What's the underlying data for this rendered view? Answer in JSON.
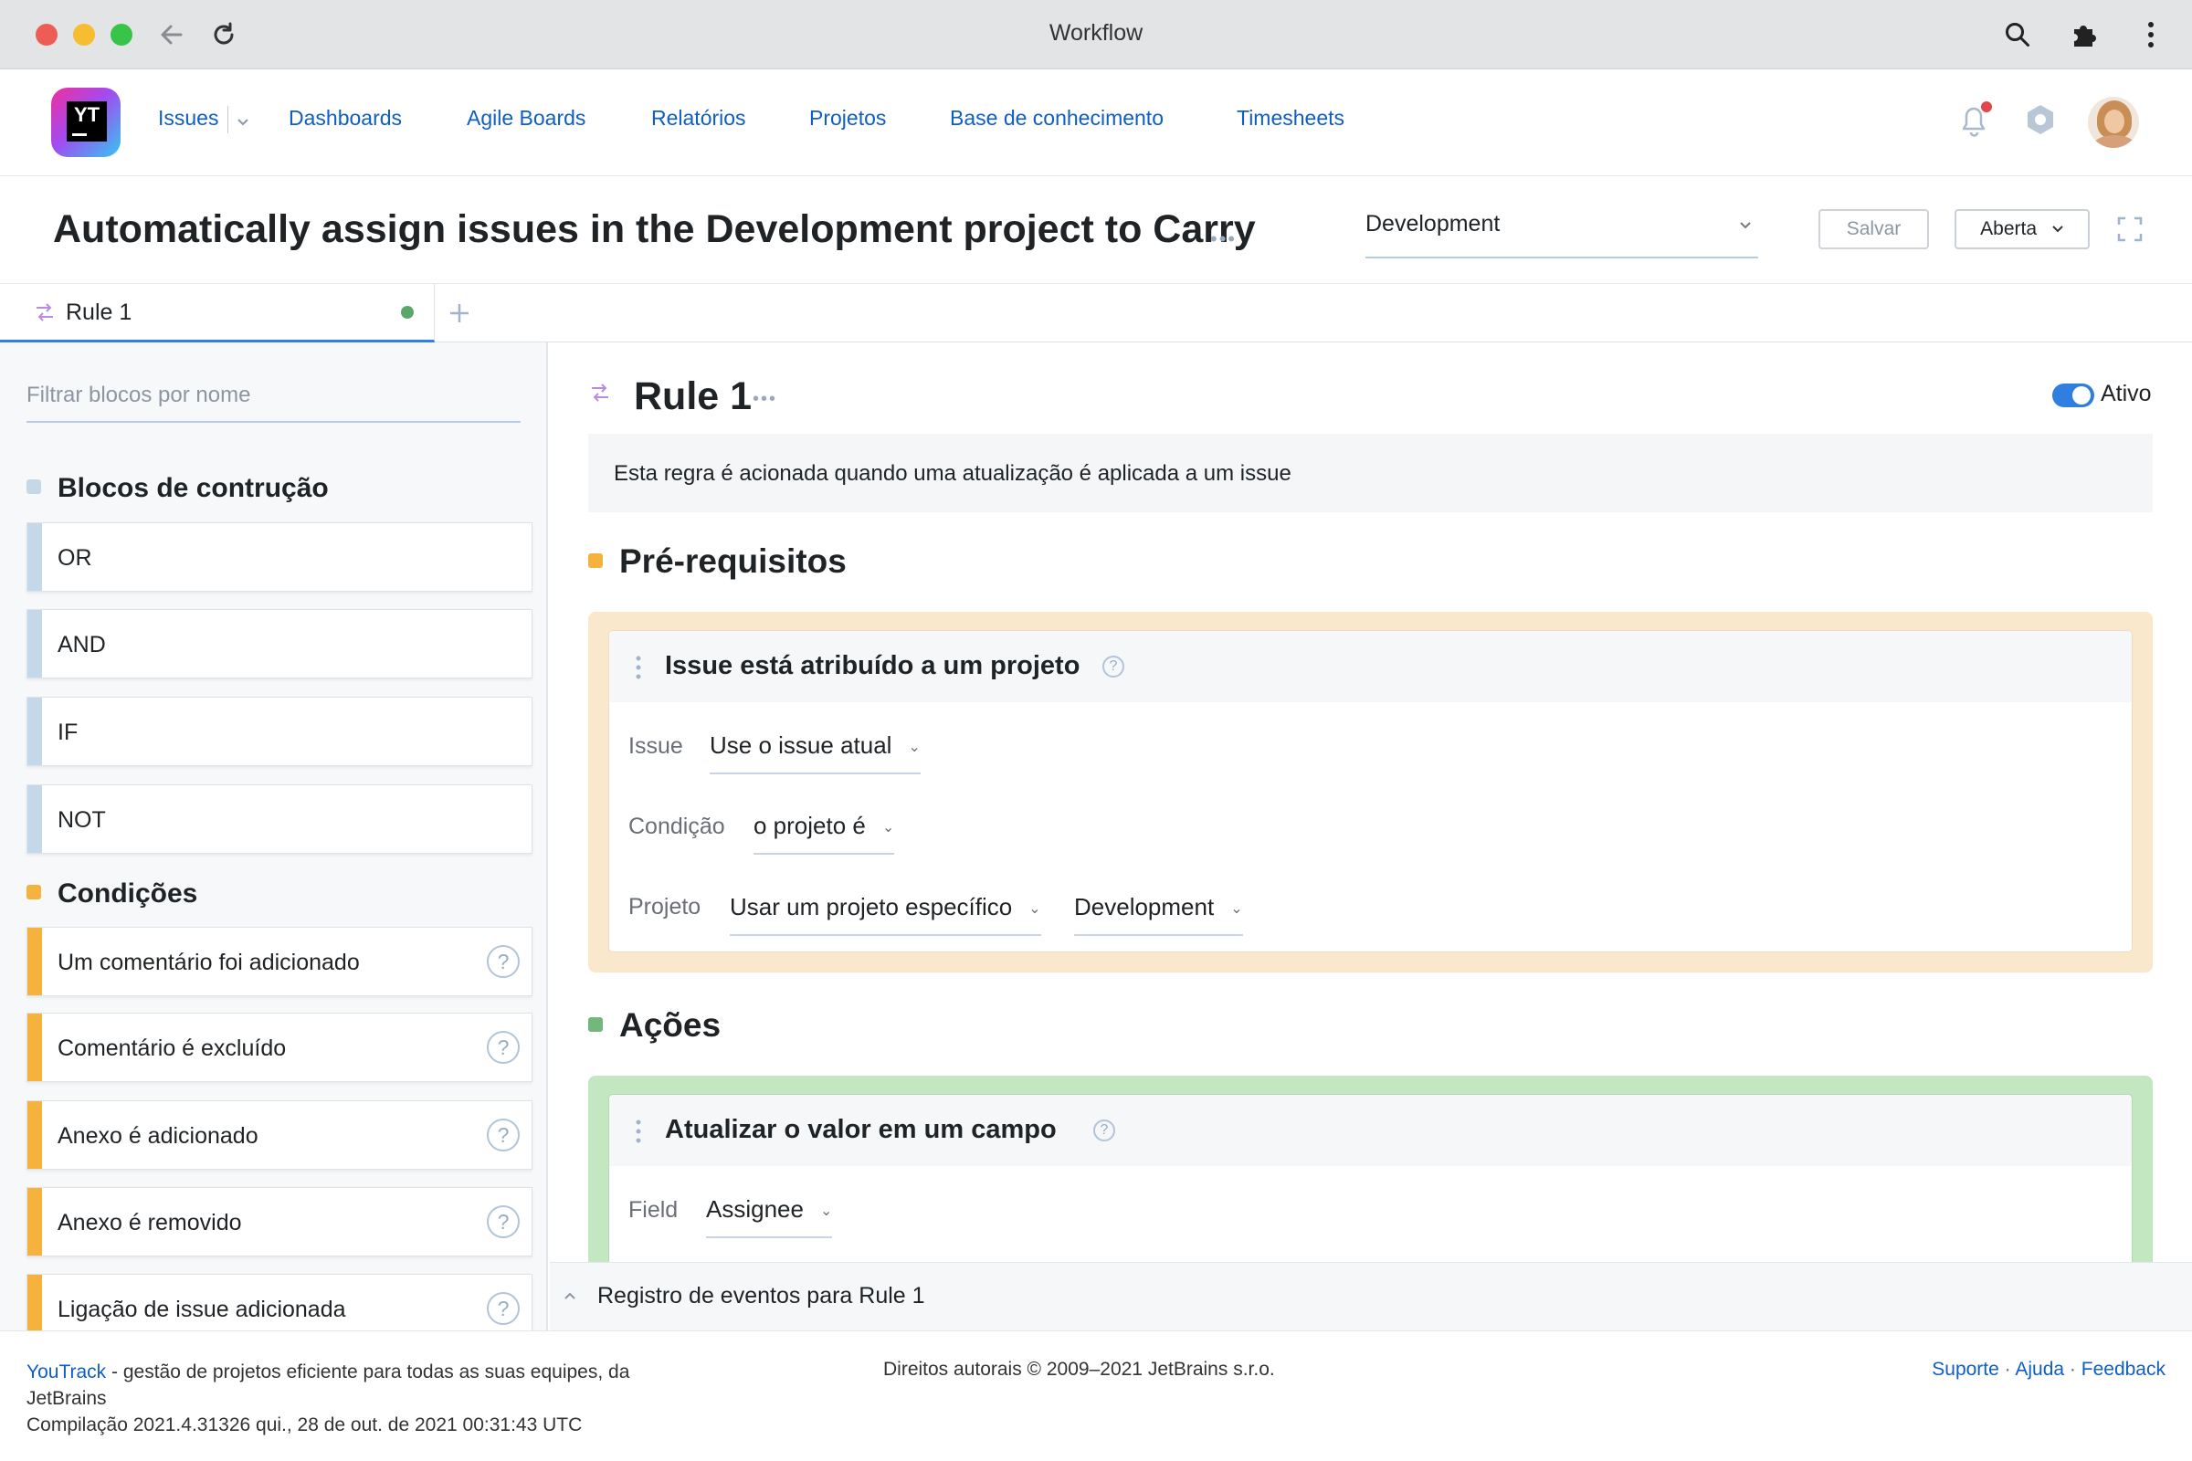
{
  "browser": {
    "title": "Workflow",
    "traffic_colors": [
      "#ee5d55",
      "#f6bd30",
      "#38c449"
    ]
  },
  "app": {
    "logo_text": "YT",
    "nav": [
      {
        "label": "Issues"
      },
      {
        "label": "Dashboards"
      },
      {
        "label": "Agile Boards"
      },
      {
        "label": "Relatórios"
      },
      {
        "label": "Projetos"
      },
      {
        "label": "Base de conhecimento"
      },
      {
        "label": "Timesheets"
      }
    ]
  },
  "page": {
    "title": "Automatically assign issues in the Development project to Carry",
    "project_select": "Development",
    "save_button": "Salvar",
    "status_button": "Aberta"
  },
  "tabs": [
    {
      "label": "Rule 1",
      "status_color": "#59a869"
    }
  ],
  "sidebar": {
    "filter_placeholder": "Filtrar blocos por nome",
    "sections": [
      {
        "title": "Blocos de contrução",
        "color": "#c5d8ea",
        "items": [
          {
            "label": "OR"
          },
          {
            "label": "AND"
          },
          {
            "label": "IF"
          },
          {
            "label": "NOT"
          }
        ]
      },
      {
        "title": "Condições",
        "color": "#f5b23d",
        "items": [
          {
            "label": "Um comentário foi adicionado"
          },
          {
            "label": "Comentário é excluído"
          },
          {
            "label": "Anexo é adicionado"
          },
          {
            "label": "Anexo é removido"
          },
          {
            "label": "Ligação de issue adicionada"
          }
        ]
      }
    ]
  },
  "rule": {
    "name": "Rule 1",
    "active_label": "Ativo",
    "active": true,
    "description": "Esta regra é acionada quando uma atualização é aplicada a um issue",
    "prereq_heading": "Pré-requisitos",
    "prereq_card": {
      "title": "Issue está atribuído a um projeto",
      "issue_label": "Issue",
      "issue_value": "Use o issue atual",
      "condition_label": "Condição",
      "condition_value": "o projeto é",
      "project_label": "Projeto",
      "project_mode": "Usar um projeto específico",
      "project_value": "Development"
    },
    "actions_heading": "Ações",
    "action_card": {
      "title": "Atualizar o valor em um campo",
      "field_label": "Field",
      "field_value": "Assignee"
    },
    "event_log": "Registro de eventos para Rule 1"
  },
  "footer": {
    "brand_link": "YouTrack",
    "tagline": "- gestão de projetos eficiente para todas as suas equipes, da",
    "tagline_2": "JetBrains",
    "build": "Compilação 2021.4.31326 qui., 28 de out. de 2021 00:31:43 UTC",
    "copyright": "Direitos autorais © 2009–2021 JetBrains s.r.o.",
    "links": {
      "support": "Suporte",
      "help": "Ajuda",
      "feedback": "Feedback"
    }
  }
}
